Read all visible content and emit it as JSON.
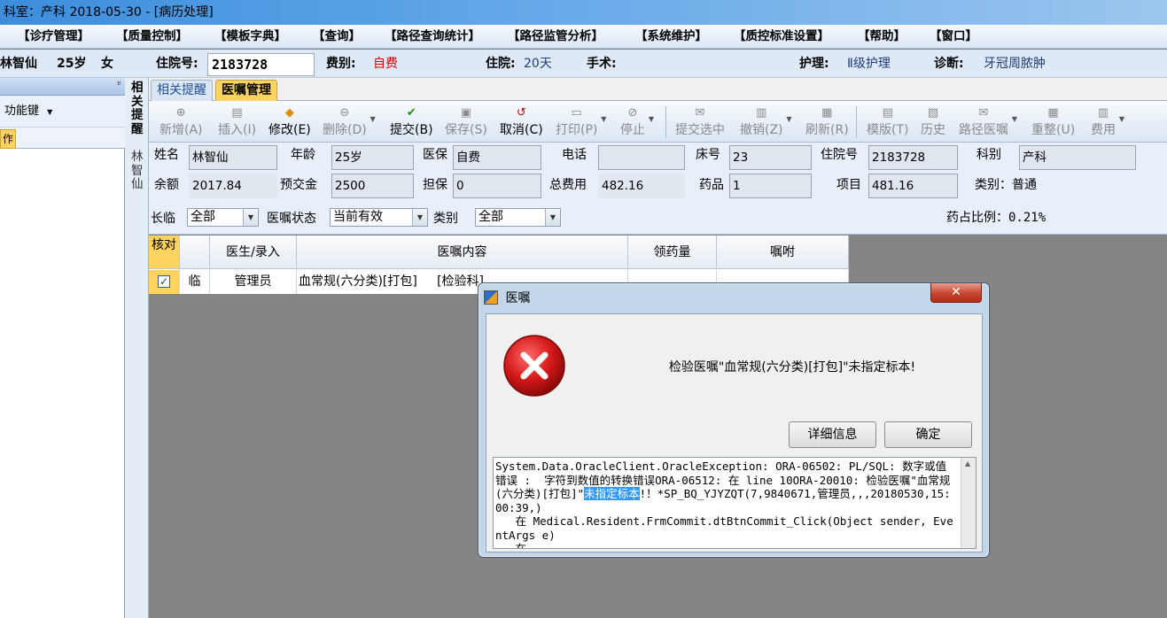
{
  "window": {
    "title": "科室：产科  2018-05-30 - [病历处理]"
  },
  "menu": [
    "【诊疗管理】",
    "【质量控制】",
    "【模板字典】",
    "【查询】",
    "【路径查询统计】",
    "【路径监管分析】",
    "【系统维护】",
    "【质控标准设置】",
    "【帮助】",
    "【窗口】"
  ],
  "patient_bar": {
    "name": "林智仙",
    "age": "25岁",
    "sex": "女",
    "inpatient_no_label": "住院号:",
    "inpatient_no": "2183728",
    "fee_type_label": "费别:",
    "fee_type": "自费",
    "stay_label": "住院:",
    "stay": "20天",
    "surgery_label": "手术:",
    "nursing_label": "护理:",
    "nursing": "Ⅱ级护理",
    "diagnosis_label": "诊断:",
    "diagnosis": "牙冠周脓肿"
  },
  "left_panel": {
    "function_key": "功能键",
    "tab_fragment": "作"
  },
  "side_strip": {
    "text1": "相关提醒",
    "text2": "林智仙"
  },
  "tabs": {
    "remind": "相关提醒",
    "orders": "医嘱管理"
  },
  "toolbar": {
    "add": "新增(A)",
    "insert": "插入(I)",
    "modify": "修改(E)",
    "delete": "删除(D)",
    "submit": "提交(B)",
    "save": "保存(S)",
    "cancel": "取消(C)",
    "print": "打印(P)",
    "stop": "停止",
    "submit_selected": "提交选中",
    "revoke": "撤销(Z)",
    "refresh": "刷新(R)",
    "template": "模版(T)",
    "history": "历史",
    "path_orders": "路径医嘱",
    "rearrange": "重整(U)",
    "cost": "费用"
  },
  "info": {
    "name_label": "姓名",
    "name": "林智仙",
    "age_label": "年龄",
    "age": "25岁",
    "insurance_label": "医保",
    "insurance": "自费",
    "phone_label": "电话",
    "phone": "",
    "bed_label": "床号",
    "bed": "23",
    "inpatient_label": "住院号",
    "inpatient": "2183728",
    "dept_label": "科别",
    "dept": "产科",
    "balance_label": "余额",
    "balance": "2017.84",
    "deposit_label": "预交金",
    "deposit": "2500",
    "guarantee_label": "担保",
    "guarantee": "0",
    "total_label": "总费用",
    "total": "482.16",
    "drug_label": "药品",
    "drug": "1",
    "item_label": "项目",
    "item": "481.16",
    "category_text": "类别：普通"
  },
  "filters": {
    "longtemp_label": "长临",
    "longtemp": "全部",
    "status_label": "医嘱状态",
    "status": "当前有效",
    "category_label": "类别",
    "category": "全部",
    "drug_ratio": "药占比例：0.21%"
  },
  "grid": {
    "headers": {
      "check": "核对",
      "doctor": "医生/录入",
      "content": "医嘱内容",
      "dose": "领药量",
      "note": "嘱咐"
    },
    "row": {
      "type": "临",
      "doctor": "管理员",
      "content": "血常规(六分类)[打包]     [检验科]"
    }
  },
  "dialog": {
    "title": "医嘱",
    "message": "检验医嘱\"血常规(六分类)[打包]\"未指定标本!",
    "details_button": "详细信息",
    "ok_button": "确定",
    "detail_1": "System.Data.OracleClient.OracleException: ORA-06502: PL/SQL: 数字或值错误 :  字符到数值的转换错误ORA-06512: 在 line 10ORA-20010: 检验医嘱\"血常规(六分类)[打包]\"",
    "detail_hl": "未指定标本",
    "detail_2": "!！*SP_BQ_YJYZQT(7,9840671,管理员,,,20180530,15:00:39,)\n   在 Medical.Resident.FrmCommit.dtBtnCommit_Click(Object sender, EventArgs e)\n   在"
  }
}
